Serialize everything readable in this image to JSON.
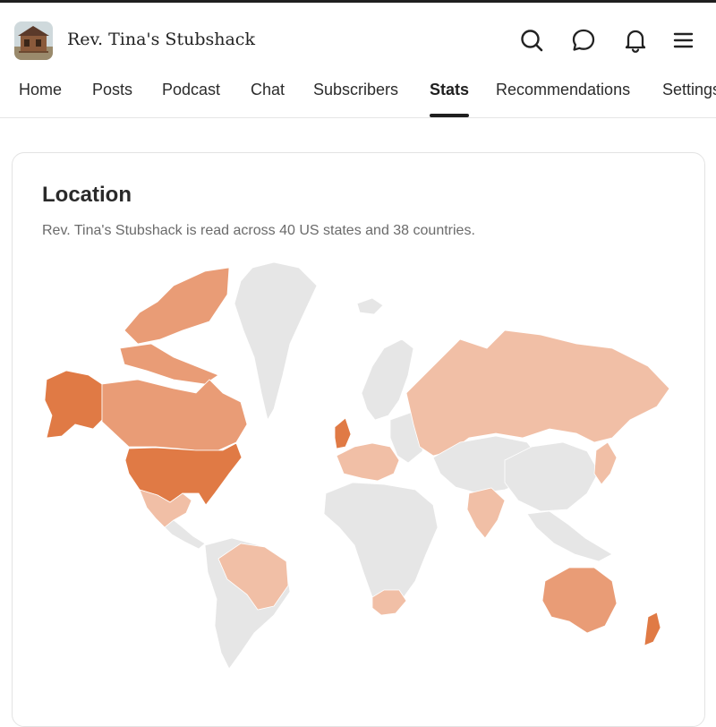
{
  "header": {
    "title": "Rev. Tina's Stubshack",
    "icons": [
      "search-icon",
      "chat-bubble-icon",
      "bell-icon",
      "menu-icon"
    ]
  },
  "nav": {
    "tabs": [
      {
        "label": "Home"
      },
      {
        "label": "Posts"
      },
      {
        "label": "Podcast"
      },
      {
        "label": "Chat"
      },
      {
        "label": "Subscribers"
      },
      {
        "label": "Stats"
      },
      {
        "label": "Recommendations"
      },
      {
        "label": "Settings"
      }
    ],
    "active": "Stats"
  },
  "location": {
    "title": "Location",
    "summary": "Rev. Tina's Stubshack is read across 40 US states and 38 countries."
  },
  "map_colors": {
    "none": "#e6e6e6",
    "low": "#f1bfa6",
    "mid": "#e99c76",
    "high": "#e07a45"
  }
}
